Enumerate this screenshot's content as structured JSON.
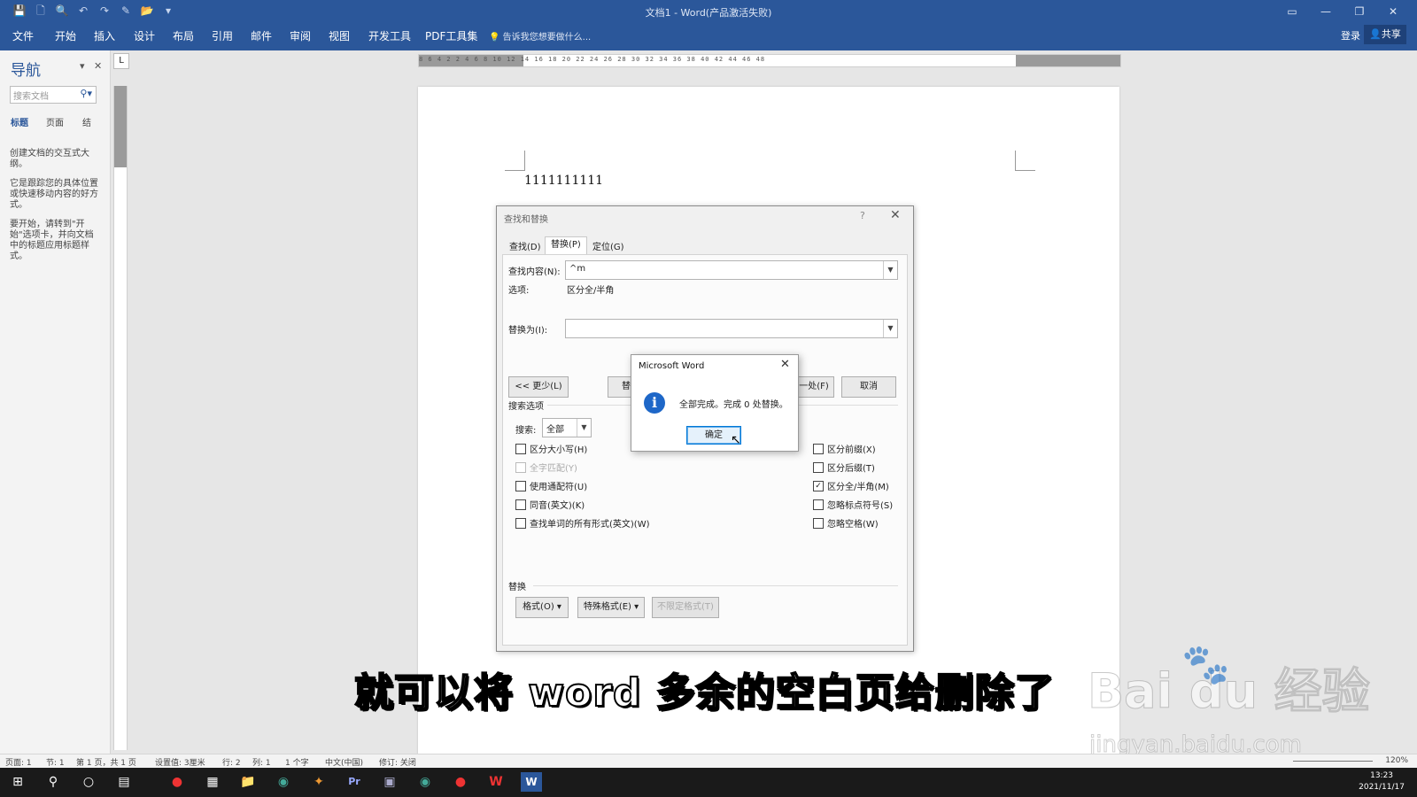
{
  "window": {
    "title": "文档1 - Word(产品激活失败)",
    "controls": [
      "▭",
      "—",
      "❐",
      "✕"
    ]
  },
  "qat": [
    "💾",
    "🗋",
    "🔍",
    "↶",
    "↷",
    "✎",
    "📂",
    "▾"
  ],
  "ribbon": {
    "tabs": [
      "文件",
      "开始",
      "插入",
      "设计",
      "布局",
      "引用",
      "邮件",
      "审阅",
      "视图",
      "开发工具",
      "PDF工具集"
    ],
    "tell_me": "告诉我您想要做什么...",
    "login": "登录",
    "share": "共享"
  },
  "nav": {
    "title": "导航",
    "search_placeholder": "搜索文档",
    "tabs": [
      "标题",
      "页面",
      "结"
    ],
    "paragraphs": [
      "创建文档的交互式大纲。",
      "它是跟踪您的具体位置或快速移动内容的好方式。",
      "要开始，请转到\"开始\"选项卡，并向文档中的标题应用标题样式。"
    ]
  },
  "ruler": {
    "corner": "L",
    "ticks": "8 6 4 2 2 4 6 8 10 12 14 16 18 20 22 24 26 28 30 32 34 36 38 40 42 44 46 48"
  },
  "document": {
    "text": "1111111111"
  },
  "find_replace": {
    "title": "查找和替换",
    "help": "?",
    "close": "✕",
    "tabs": [
      "查找(D)",
      "替换(P)",
      "定位(G)"
    ],
    "find_label": "查找内容(N):",
    "find_value": "^m",
    "options_label": "选项:",
    "options_value": "区分全/半角",
    "replace_label": "替换为(I):",
    "replace_value": "",
    "buttons": {
      "less": "<< 更少(L)",
      "replace": "替",
      "find_next": "下一处(F)",
      "cancel": "取消"
    },
    "search_options_label": "搜索选项",
    "search_label": "搜索:",
    "search_value": "全部",
    "left_checks": [
      {
        "label": "区分大小写(H)",
        "checked": false,
        "disabled": false
      },
      {
        "label": "全字匹配(Y)",
        "checked": false,
        "disabled": true
      },
      {
        "label": "使用通配符(U)",
        "checked": false,
        "disabled": false
      },
      {
        "label": "同音(英文)(K)",
        "checked": false,
        "disabled": false
      },
      {
        "label": "查找单词的所有形式(英文)(W)",
        "checked": false,
        "disabled": false
      }
    ],
    "right_checks": [
      {
        "label": "区分前缀(X)",
        "checked": false,
        "disabled": false
      },
      {
        "label": "区分后缀(T)",
        "checked": false,
        "disabled": false
      },
      {
        "label": "区分全/半角(M)",
        "checked": true,
        "disabled": false
      },
      {
        "label": "忽略标点符号(S)",
        "checked": false,
        "disabled": false
      },
      {
        "label": "忽略空格(W)",
        "checked": false,
        "disabled": false
      }
    ],
    "replace_section": "替换",
    "format_btn": "格式(O) ▾",
    "special_btn": "特殊格式(E) ▾",
    "no_format_btn": "不限定格式(T)"
  },
  "msgbox": {
    "title": "Microsoft Word",
    "close": "✕",
    "icon": "i",
    "text": "全部完成。完成 0 处替换。",
    "ok": "确定"
  },
  "subtitle": "就可以将 word 多余的空白页给删除了",
  "watermark": {
    "logo": "Bai  du 经验",
    "paw": "🐾",
    "url": "jingyan.baidu.com"
  },
  "status": {
    "items": [
      "页面: 1",
      "节: 1",
      "第 1 页，共 1 页",
      "设置值: 3厘米",
      "行: 2",
      "列: 1",
      "1 个字",
      "中文(中国)",
      "修订: 关闭"
    ],
    "zoom": "120%"
  },
  "taskbar": {
    "icons": [
      "⊞",
      "⚲",
      "○",
      "▤",
      "●",
      "▦",
      "📁",
      "◉",
      "✦",
      "Pr",
      "▣",
      "◉",
      "●",
      "W",
      "W"
    ],
    "time": "13:23",
    "date": "2021/11/17"
  },
  "colors": {
    "word_blue": "#2b579a",
    "dialog_bg": "#f0f0f0",
    "info_blue": "#1e67c8"
  }
}
